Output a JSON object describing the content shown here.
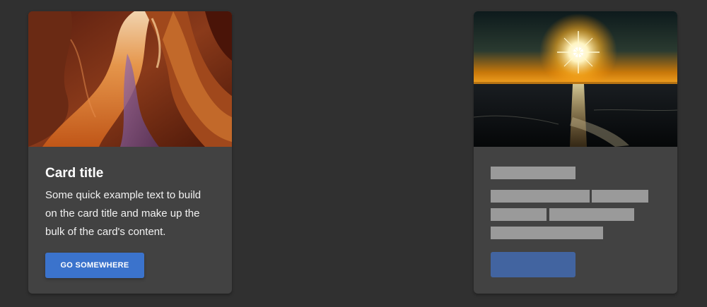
{
  "cards": [
    {
      "image": "canyon-photo",
      "title": "Card title",
      "text": "Some quick example text to build on the card title and make up the bulk of the card's content.",
      "button_label": "GO SOMEWHERE"
    },
    {
      "image": "sunset-sea-photo",
      "state": "loading-placeholder"
    }
  ],
  "colors": {
    "background": "#303030",
    "card": "#424242",
    "button": "#3b73cc",
    "placeholder": "#9a9a9a",
    "placeholder_button": "#4264a0"
  }
}
